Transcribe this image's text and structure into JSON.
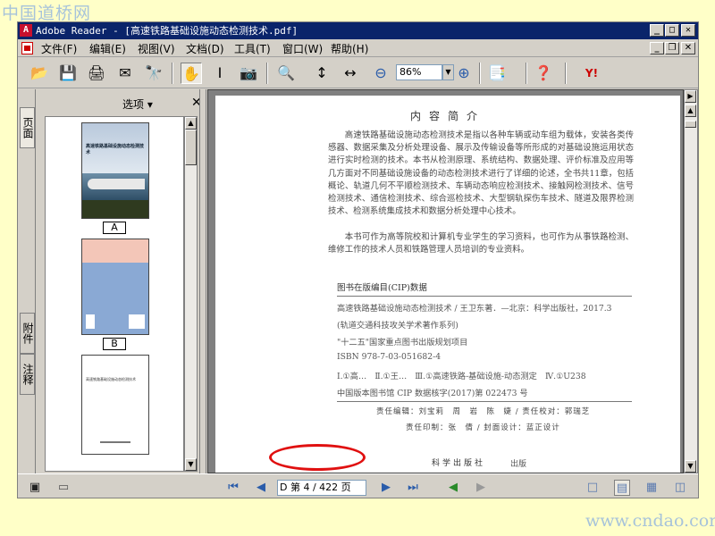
{
  "watermark": {
    "top": "中国道桥网",
    "bottom": "www.cndao.com"
  },
  "window": {
    "title": "Adobe Reader - [高速铁路基础设施动态检测技术.pdf]"
  },
  "menubar": {
    "items": [
      "文件(F)",
      "编辑(E)",
      "视图(V)",
      "文档(D)",
      "工具(T)",
      "窗口(W)",
      "帮助(H)"
    ]
  },
  "toolbar": {
    "zoom_value": "86%"
  },
  "left_tabs": [
    "页面",
    "附件",
    "注释"
  ],
  "pages_panel": {
    "options_label": "选项",
    "thumbnails": [
      {
        "label": "A",
        "cover_title": "高速铁路基础设施动态检测技术"
      },
      {
        "label": "B"
      },
      {
        "label": "",
        "inner_title": "高速铁路基础设施动态检测技术"
      }
    ]
  },
  "document": {
    "heading": "内容简介",
    "paragraph1": "高速铁路基础设施动态检测技术是指以各种车辆或动车组为载体，安装各类传感器、数据采集及分析处理设备、展示及传输设备等所形成的对基础设施运用状态进行实时检测的技术。本书从检测原理、系统结构、数据处理、评价标准及应用等几方面对不同基础设施设备的动态检测技术进行了详细的论述，全书共11章，包括概论、轨道几何不平顺检测技术、车辆动态响应检测技术、接触网检测技术、信号检测技术、通信检测技术、综合巡检技术、大型钢轨探伤车技术、隧道及限界检测技术、检测系统集成技术和数据分析处理中心技术。",
    "paragraph2": "本书可作为高等院校和计算机专业学生的学习资料，也可作为从事铁路检测、维修工作的技术人员和铁路管理人员培训的专业资料。",
    "cip_title": "图书在版编目(CIP)数据",
    "cip_lines": [
      "高速铁路基础设施动态检测技术 / 王卫东著．—北京：科学出版社，2017.3",
      "(轨道交通科技攻关学术著作系列)",
      "\"十二五\"国家重点图书出版规划项目",
      "ISBN 978-7-03-051682-4",
      "Ⅰ.①高…　Ⅱ.①王…　Ⅲ.①高速铁路-基础设施-动态测定　Ⅳ.①U238",
      "中国版本图书馆 CIP 数据核字(2017)第 022473 号"
    ],
    "credit1": "责任编辑：刘宝莉　周　岩　陈　婕 / 责任校对：郭瑞芝",
    "credit2": "责任印制：张　倩 / 封面设计：蓝正设计",
    "publisher": "科学出版社",
    "publisher_tail": "出版"
  },
  "statusbar": {
    "page_prefix": "D",
    "page_display": "第 4 / 422 页"
  },
  "colors": {
    "title_bar": "#0a246a",
    "annotation": "#e01010",
    "watermark": "#a7c3da"
  }
}
